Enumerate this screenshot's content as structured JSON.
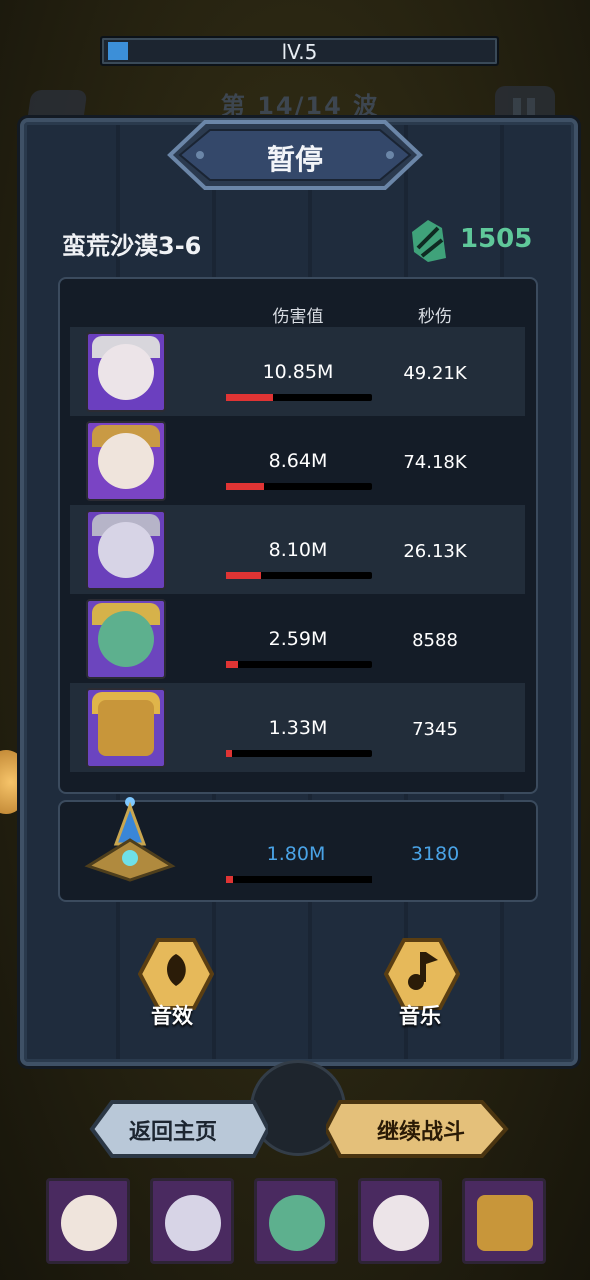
{
  "hud": {
    "level": "lV.5",
    "level_progress": 0.05,
    "wave": "第 14/14 波"
  },
  "dialog": {
    "title": "暂停",
    "stage": "蛮荒沙漠3-6",
    "score": "1505"
  },
  "table": {
    "col_damage": "伤害值",
    "col_dps": "秒伤",
    "rows": [
      {
        "damage": "10.85M",
        "dps": "49.21K",
        "bar": 0.32
      },
      {
        "damage": "8.64M",
        "dps": "74.18K",
        "bar": 0.26
      },
      {
        "damage": "8.10M",
        "dps": "26.13K",
        "bar": 0.24
      },
      {
        "damage": "2.59M",
        "dps": "8588",
        "bar": 0.08
      },
      {
        "damage": "1.33M",
        "dps": "7345",
        "bar": 0.04
      }
    ],
    "artifact": {
      "damage": "1.80M",
      "dps": "3180",
      "bar": 0.05
    }
  },
  "options": {
    "sound": "音效",
    "music": "音乐"
  },
  "buttons": {
    "home": "返回主页",
    "continue": "继续战斗"
  },
  "colors": {
    "damage_bar": "#e03434",
    "score": "#5fc89a",
    "artifact_text": "#4aa3e6",
    "continue_button": "#e4c07a",
    "home_button": "#b9c8d8"
  }
}
